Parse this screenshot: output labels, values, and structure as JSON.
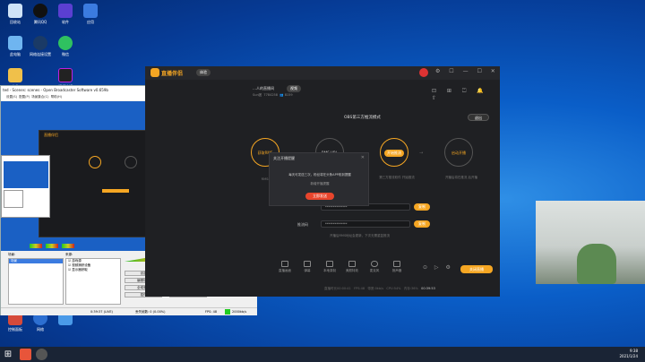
{
  "desktop": {
    "icons": [
      {
        "name": "recycle-bin",
        "label": "回收站"
      },
      {
        "name": "qq",
        "label": "腾讯QQ"
      },
      {
        "name": "app3",
        "label": "软件"
      },
      {
        "name": "app4",
        "label": "应用"
      },
      {
        "name": "computer",
        "label": "此电脑"
      },
      {
        "name": "network",
        "label": "网络连接设置"
      },
      {
        "name": "wechat",
        "label": "微信"
      },
      {
        "name": "folder",
        "label": "文件"
      },
      {
        "name": "video",
        "label": "视频编辑"
      },
      {
        "name": "bottom1",
        "label": "控制面板"
      },
      {
        "name": "bottom2",
        "label": "网络"
      }
    ]
  },
  "obs": {
    "title": "ted - Scenes: scenes - Open Broadcaster Software v0.659b",
    "menu": [
      "设置(S)",
      "配置(P)",
      "场景集合(C)",
      "帮助(H)"
    ],
    "panel_scenes": "场景:",
    "panel_sources": "来源:",
    "scene_item": "场景",
    "sources": [
      "游戏源",
      "视频捕获设备",
      "显示器获取"
    ],
    "buttons": [
      "设定",
      "停止串流",
      "编辑场景",
      "开始录制",
      "全域来源",
      "预览串流",
      "插件",
      "退出"
    ],
    "status": "0:39:37 (LIVE)",
    "dropped": "丢失帧数: 0 (0.00%)",
    "fps": "FPS: 48",
    "bitrate": "2000kb/s"
  },
  "app": {
    "logo": "直播伴侣",
    "logo_badge": "体验",
    "room_title": "…人的直播间",
    "room_badge": "视频",
    "room_id": "Sun团",
    "fans": "7784258",
    "count": "8159",
    "mode_title": "OBS第三方推流模式",
    "exit": "退出",
    "steps": [
      "获取RMS",
      "RMS URL",
      "开始推流",
      "启动开播"
    ],
    "step_caps": [
      "RMS地址",
      "",
      "第三方推流软件\n开始推流",
      "开播后将在推流\n后开播"
    ],
    "url_placeholder": "**************",
    "copy": "复制",
    "key_label": "推流码",
    "key_value": "**************",
    "hint": "开播后RMS地址会更新，下次无需重复推流",
    "tools": [
      "直播画面",
      "弹幕",
      "本地录制",
      "美颜特效",
      "麦克风",
      "扬声器"
    ],
    "live_btn": "关闭直播",
    "status_bar": [
      "直播时长00:00:41",
      "FPS:48",
      "带宽:0kb/s",
      "CPU:54%",
      "内存:36%",
      "00:39:53"
    ]
  },
  "dialog": {
    "title": "关注开播提醒",
    "line1": "每天可发送三次，粉丝将在头条APP收到提醒",
    "line2": "新增开播提醒",
    "button": "立即发送"
  },
  "taskbar": {
    "time": "9:38",
    "date": "2021/1/24"
  },
  "colors": {
    "accent": "#f5a623",
    "app_bg": "#1f2023",
    "desktop": "#0a5ec8"
  }
}
